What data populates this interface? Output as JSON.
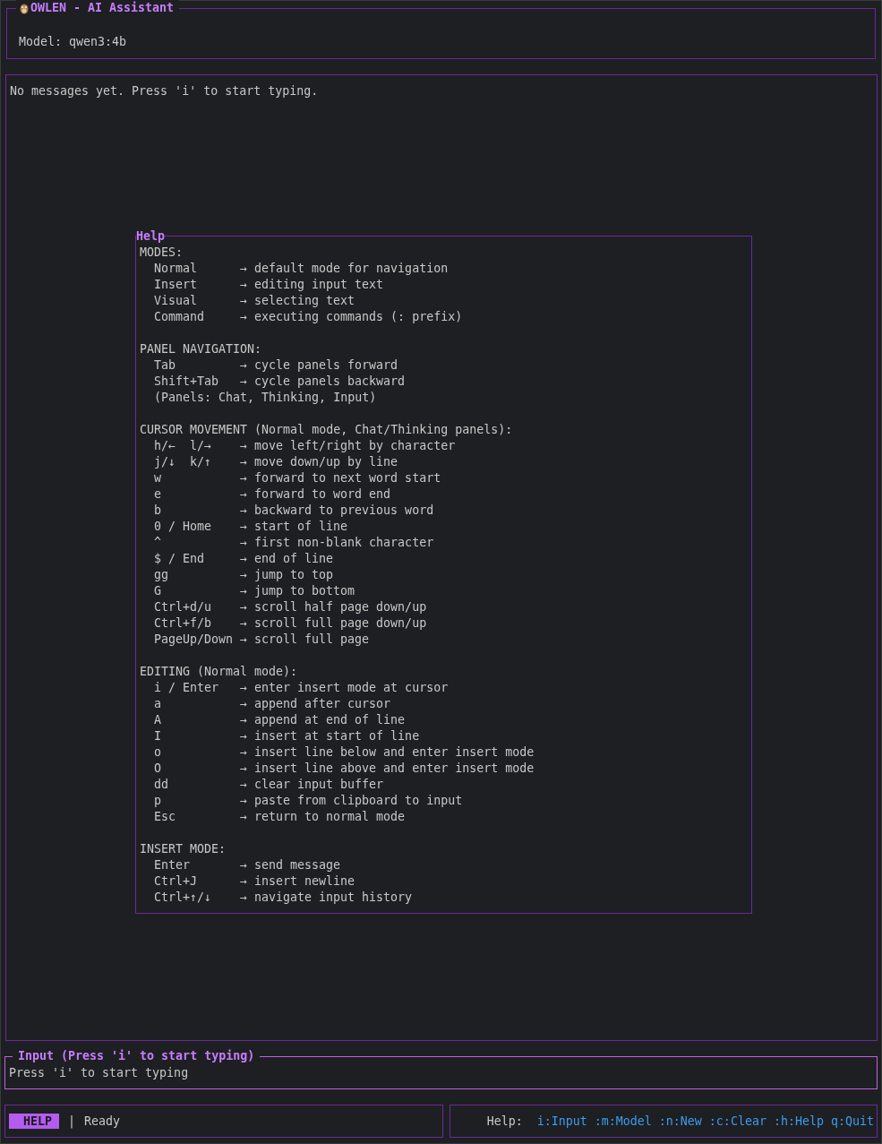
{
  "header": {
    "title": "OWLEN - AI Assistant",
    "model": "Model: qwen3:4b"
  },
  "chat": {
    "empty_message": "No messages yet. Press 'i' to start typing."
  },
  "help": {
    "title": "Help",
    "sections": [
      {
        "heading": "MODES:",
        "entries": [
          {
            "kind": "binding",
            "key": "Normal",
            "action": "→ default mode for navigation"
          },
          {
            "kind": "binding",
            "key": "Insert",
            "action": "→ editing input text"
          },
          {
            "kind": "binding",
            "key": "Visual",
            "action": "→ selecting text"
          },
          {
            "kind": "binding",
            "key": "Command",
            "action": "→ executing commands (: prefix)"
          }
        ]
      },
      {
        "heading": "PANEL NAVIGATION:",
        "entries": [
          {
            "kind": "binding",
            "key": "Tab",
            "action": "→ cycle panels forward"
          },
          {
            "kind": "binding",
            "key": "Shift+Tab",
            "action": "→ cycle panels backward"
          },
          {
            "kind": "note",
            "text": "(Panels: Chat, Thinking, Input)"
          }
        ]
      },
      {
        "heading": "CURSOR MOVEMENT (Normal mode, Chat/Thinking panels):",
        "entries": [
          {
            "kind": "binding",
            "key": "h/←  l/→",
            "action": "→ move left/right by character"
          },
          {
            "kind": "binding",
            "key": "j/↓  k/↑",
            "action": "→ move down/up by line"
          },
          {
            "kind": "binding",
            "key": "w",
            "action": "→ forward to next word start"
          },
          {
            "kind": "binding",
            "key": "e",
            "action": "→ forward to word end"
          },
          {
            "kind": "binding",
            "key": "b",
            "action": "→ backward to previous word"
          },
          {
            "kind": "binding",
            "key": "0 / Home",
            "action": "→ start of line"
          },
          {
            "kind": "binding",
            "key": "^",
            "action": "→ first non-blank character"
          },
          {
            "kind": "binding",
            "key": "$ / End",
            "action": "→ end of line"
          },
          {
            "kind": "binding",
            "key": "gg",
            "action": "→ jump to top"
          },
          {
            "kind": "binding",
            "key": "G",
            "action": "→ jump to bottom"
          },
          {
            "kind": "binding",
            "key": "Ctrl+d/u",
            "action": "→ scroll half page down/up"
          },
          {
            "kind": "binding",
            "key": "Ctrl+f/b",
            "action": "→ scroll full page down/up"
          },
          {
            "kind": "binding",
            "key": "PageUp/Down",
            "action": "→ scroll full page"
          }
        ]
      },
      {
        "heading": "EDITING (Normal mode):",
        "entries": [
          {
            "kind": "binding",
            "key": "i / Enter",
            "action": "→ enter insert mode at cursor"
          },
          {
            "kind": "binding",
            "key": "a",
            "action": "→ append after cursor"
          },
          {
            "kind": "binding",
            "key": "A",
            "action": "→ append at end of line"
          },
          {
            "kind": "binding",
            "key": "I",
            "action": "→ insert at start of line"
          },
          {
            "kind": "binding",
            "key": "o",
            "action": "→ insert line below and enter insert mode"
          },
          {
            "kind": "binding",
            "key": "O",
            "action": "→ insert line above and enter insert mode"
          },
          {
            "kind": "binding",
            "key": "dd",
            "action": "→ clear input buffer"
          },
          {
            "kind": "binding",
            "key": "p",
            "action": "→ paste from clipboard to input"
          },
          {
            "kind": "binding",
            "key": "Esc",
            "action": "→ return to normal mode"
          }
        ]
      },
      {
        "heading": "INSERT MODE:",
        "entries": [
          {
            "kind": "binding",
            "key": "Enter",
            "action": "→ send message"
          },
          {
            "kind": "binding",
            "key": "Ctrl+J",
            "action": "→ insert newline"
          },
          {
            "kind": "binding",
            "key": "Ctrl+↑/↓",
            "action": "→ navigate input history"
          }
        ]
      }
    ]
  },
  "input": {
    "title": "Input (Press 'i' to start typing)",
    "placeholder": "Press 'i' to start typing"
  },
  "status_bar": {
    "mode": "HELP",
    "separator": "|",
    "status": "Ready",
    "help_label": "Help:",
    "shortcuts": [
      "i:Input",
      ":m:Model",
      ":n:New",
      ":c:Clear",
      ":h:Help",
      "q:Quit"
    ]
  }
}
